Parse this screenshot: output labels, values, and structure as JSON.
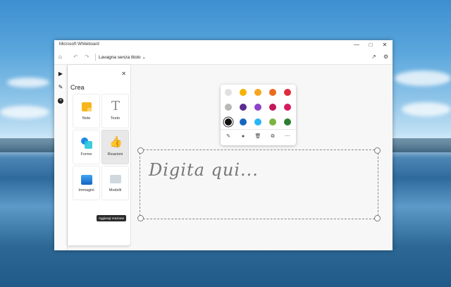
{
  "window": {
    "title": "Microsoft Whiteboard",
    "minimize_icon": "minimize-icon",
    "maximize_icon": "maximize-icon",
    "close_icon": "close-icon"
  },
  "toolbar": {
    "board_title": "Lavagna senza titolo",
    "home_icon": "home-icon",
    "undo_icon": "undo-icon",
    "redo_icon": "redo-icon",
    "share_icon": "share-icon",
    "settings_icon": "gear-icon"
  },
  "create_panel": {
    "title": "Crea",
    "items": [
      {
        "label": "Note",
        "icon": "note-icon"
      },
      {
        "label": "Testo",
        "icon": "text-icon"
      },
      {
        "label": "Forme",
        "icon": "shapes-icon"
      },
      {
        "label": "Reazioni",
        "icon": "reaction-icon"
      },
      {
        "label": "Immagini",
        "icon": "image-icon"
      },
      {
        "label": "Modelli",
        "icon": "templates-icon"
      }
    ],
    "tooltip": "Aggiungi reazione"
  },
  "palette": {
    "colors": [
      "#e0e0e0",
      "#f4b400",
      "#f6a623",
      "#ea6c1e",
      "#e02b3c",
      "#b8b8b8",
      "#5b2d91",
      "#8e44c8",
      "#c2185b",
      "#d81b60",
      "#111111",
      "#1565c0",
      "#29b6f6",
      "#7cb342",
      "#2e7d32"
    ],
    "selected_index": 10,
    "tools": [
      "pen-icon",
      "dot-icon",
      "delete-icon",
      "copy-format-icon",
      "more-icon"
    ]
  },
  "note": {
    "text": "Digita qui..."
  }
}
